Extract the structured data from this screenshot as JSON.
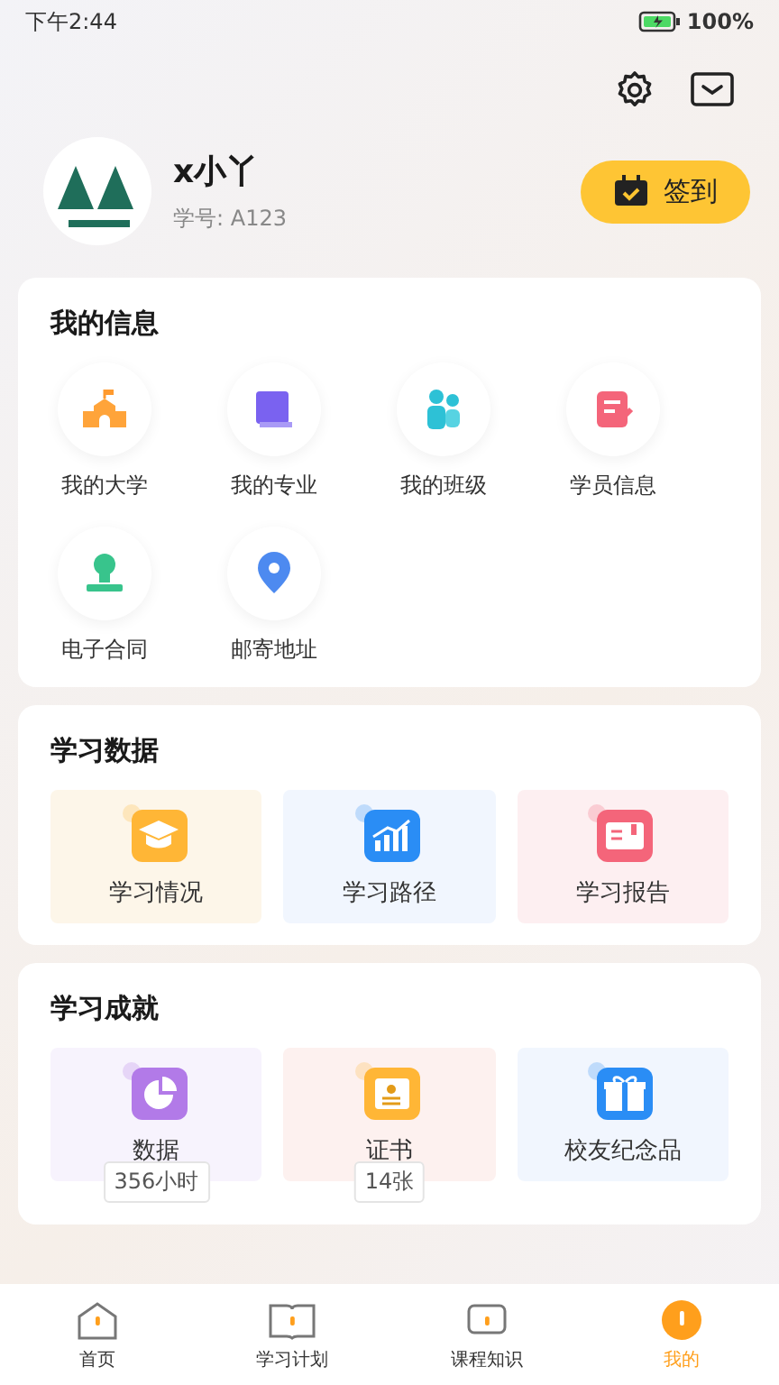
{
  "status_bar": {
    "time": "下午2:44",
    "battery": "100%"
  },
  "profile": {
    "name": "x小丫",
    "student_id": "学号: A123",
    "checkin_button": "签到"
  },
  "info_section": {
    "title": "我的信息",
    "items": [
      {
        "label": "我的大学"
      },
      {
        "label": "我的专业"
      },
      {
        "label": "我的班级"
      },
      {
        "label": "学员信息"
      },
      {
        "label": "电子合同"
      },
      {
        "label": "邮寄地址"
      }
    ]
  },
  "data_section": {
    "title": "学习数据",
    "items": [
      {
        "label": "学习情况",
        "color": "#fdf6e9"
      },
      {
        "label": "学习路径",
        "color": "#f1f6fe"
      },
      {
        "label": "学习报告",
        "color": "#fdeff1"
      }
    ]
  },
  "achievement_section": {
    "title": "学习成就",
    "items": [
      {
        "label": "数据",
        "color": "#f7f3fd",
        "badge": "356小时"
      },
      {
        "label": "证书",
        "color": "#fdf1ef",
        "badge": "14张"
      },
      {
        "label": "校友纪念品",
        "color": "#f1f6fe"
      }
    ]
  },
  "tabs": [
    {
      "label": "首页",
      "selected": false
    },
    {
      "label": "学习计划",
      "selected": false
    },
    {
      "label": "课程知识",
      "selected": false
    },
    {
      "label": "我的",
      "selected": true
    }
  ]
}
